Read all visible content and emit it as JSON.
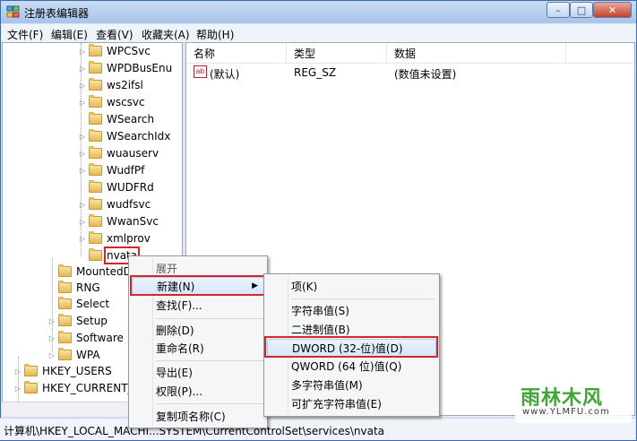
{
  "window": {
    "title": "注册表编辑器",
    "controls": {
      "min": "–",
      "max": "□",
      "close": "✕"
    }
  },
  "menubar": [
    "文件(F)",
    "编辑(E)",
    "查看(V)",
    "收藏夹(A)",
    "帮助(H)"
  ],
  "tree": {
    "items": [
      {
        "label": "WPCSvc",
        "arrow": "▷"
      },
      {
        "label": "WPDBusEnu",
        "arrow": "▷"
      },
      {
        "label": "ws2ifsl",
        "arrow": "▷"
      },
      {
        "label": "wscsvc",
        "arrow": "▷"
      },
      {
        "label": "WSearch",
        "arrow": ""
      },
      {
        "label": "WSearchIdx",
        "arrow": "▷"
      },
      {
        "label": "wuauserv",
        "arrow": "▷"
      },
      {
        "label": "WudfPf",
        "arrow": "▷"
      },
      {
        "label": "WUDFRd",
        "arrow": ""
      },
      {
        "label": "wudfsvc",
        "arrow": "▷"
      },
      {
        "label": "WwanSvc",
        "arrow": "▷"
      },
      {
        "label": "xmlprov",
        "arrow": "▷"
      },
      {
        "label": "nvata",
        "arrow": ""
      },
      {
        "label": "MountedD",
        "arrow": ""
      },
      {
        "label": "RNG",
        "arrow": ""
      },
      {
        "label": "Select",
        "arrow": ""
      },
      {
        "label": "Setup",
        "arrow": "▷"
      },
      {
        "label": "Software",
        "arrow": "▷"
      },
      {
        "label": "WPA",
        "arrow": "▷"
      },
      {
        "label": "HKEY_USERS",
        "arrow": "▷"
      },
      {
        "label": "HKEY_CURRENT_",
        "arrow": "▷"
      }
    ]
  },
  "list": {
    "headers": [
      "名称",
      "类型",
      "数据"
    ],
    "rows": [
      {
        "icon": "ab",
        "name": "(默认)",
        "type": "REG_SZ",
        "data": "(数值未设置)"
      }
    ]
  },
  "context_menu": [
    "展开",
    "新建(N)",
    "查找(F)...",
    "删除(D)",
    "重命名(R)",
    "导出(E)",
    "权限(P)...",
    "复制项名称(C)"
  ],
  "submenu": [
    "项(K)",
    "字符串值(S)",
    "二进制值(B)",
    "DWORD (32-位)值(D)",
    "QWORD (64 位)值(Q)",
    "多字符串值(M)",
    "可扩充字符串值(E)"
  ],
  "status": "计算机\\HKEY_LOCAL_MACHI...SYSTEM\\CurrentControlSet\\services\\nvata",
  "watermark": {
    "main": "雨林木风",
    "sub": "www.YLMFU.com"
  },
  "colors": {
    "highlight_border": "#d6262a",
    "title_gradient": "#a8c4ea",
    "folder": "#e8b94e"
  }
}
